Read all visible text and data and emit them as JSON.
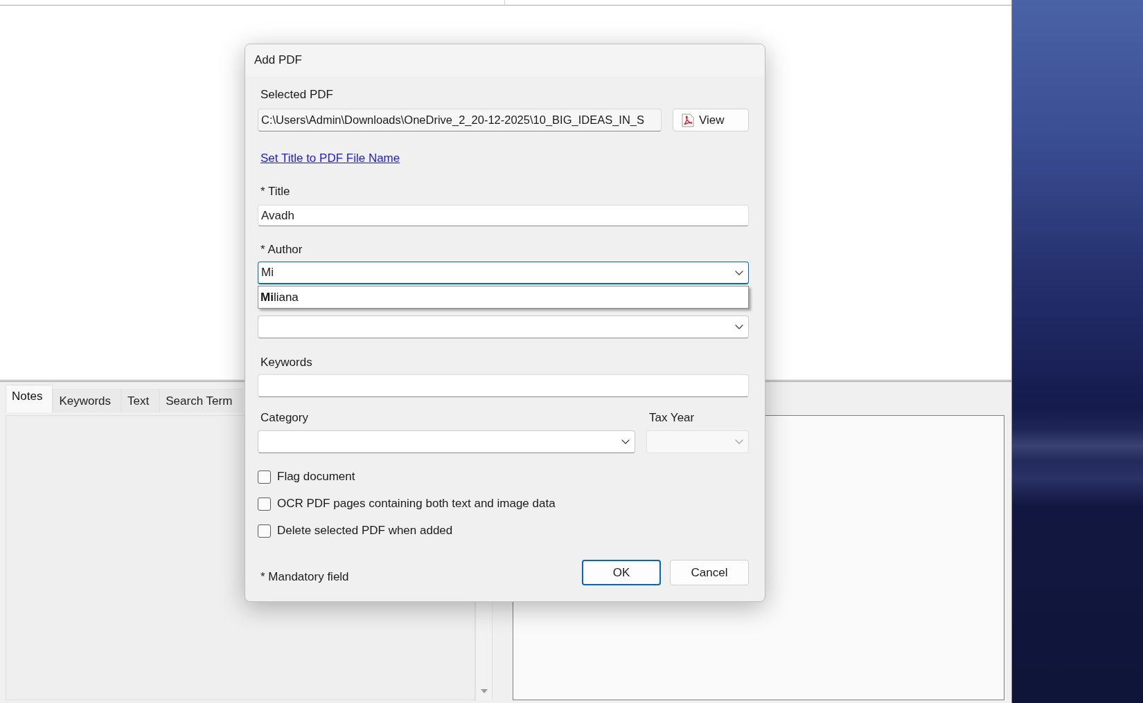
{
  "main_window": {
    "tabs": [
      {
        "label": "Notes",
        "selected": true
      },
      {
        "label": "Keywords",
        "selected": false
      },
      {
        "label": "Text",
        "selected": false
      },
      {
        "label": "Search Term",
        "selected": false
      }
    ]
  },
  "dialog": {
    "title": "Add PDF",
    "selected_pdf": {
      "label": "Selected PDF",
      "value": "C:\\Users\\Admin\\Downloads\\OneDrive_2_20-12-2025\\10_BIG_IDEAS_IN_S",
      "button": "View"
    },
    "title_link": "Set Title to PDF File Name",
    "title_field": {
      "label": "* Title",
      "value": "Avadh"
    },
    "author": {
      "label": "* Author",
      "value": "Mi",
      "focused": true,
      "suggestions": [
        "**Mi**liana"
      ]
    },
    "covered_field": {
      "kind": "dropdown"
    },
    "keywords": {
      "label": "Keywords",
      "kind": "text"
    },
    "category": {
      "label": "Category",
      "disabled": false
    },
    "tax_year": {
      "label": "Tax Year",
      "disabled": true
    },
    "checkboxes": [
      {
        "label": "Flag document",
        "checked": false
      },
      {
        "label": "OCR PDF pages containing both text and image data",
        "checked": false
      },
      {
        "label": "Delete selected PDF when added",
        "checked": false
      }
    ],
    "mandatory_note": "* Mandatory field",
    "buttons": [
      {
        "label": "OK",
        "default": true
      },
      {
        "label": "Cancel",
        "default": false
      }
    ]
  }
}
